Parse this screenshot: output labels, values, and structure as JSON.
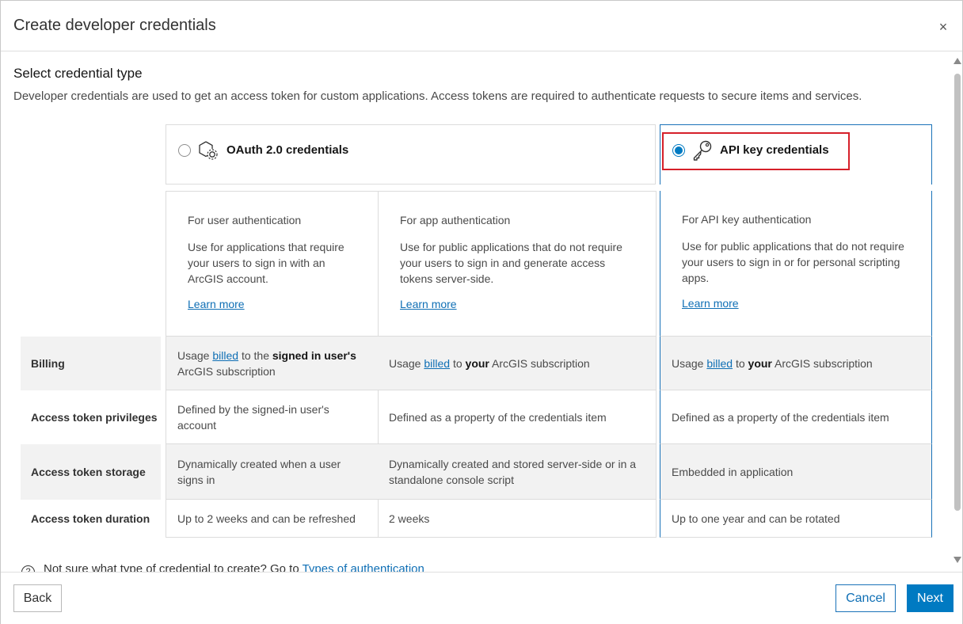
{
  "dialog": {
    "title": "Create developer credentials",
    "close_label": "×"
  },
  "section": {
    "title": "Select credential type",
    "description": "Developer credentials are used to get an access token for custom applications. Access tokens are required to authenticate requests to secure items and services."
  },
  "options": {
    "oauth": {
      "label": "OAuth 2.0 credentials",
      "selected": false,
      "icon": "gear-hexagon-icon"
    },
    "api_key": {
      "label": "API key credentials",
      "selected": true,
      "icon": "key-icon"
    }
  },
  "descriptions": [
    {
      "subtitle": "For user authentication",
      "body": "Use for applications that require your users to sign in with an ArcGIS account.",
      "link": "Learn more"
    },
    {
      "subtitle": "For app authentication",
      "body": "Use for public applications that do not require your users to sign in and generate access tokens server-side.",
      "link": "Learn more"
    },
    {
      "subtitle": "For API key authentication",
      "body": "Use for public applications that do not require your users to sign in or for personal scripting apps.",
      "link": "Learn more"
    }
  ],
  "table": {
    "rows": [
      {
        "label": "Billing",
        "cells": [
          {
            "pre": "Usage ",
            "link": "billed",
            "mid": " to the ",
            "bold": "signed in user's",
            "post": " ArcGIS subscription"
          },
          {
            "pre": "Usage ",
            "link": "billed",
            "mid": " to ",
            "bold": "your",
            "post": " ArcGIS subscription"
          },
          {
            "pre": "Usage ",
            "link": "billed",
            "mid": " to ",
            "bold": "your",
            "post": " ArcGIS subscription"
          }
        ]
      },
      {
        "label": "Access token privileges",
        "cells": [
          {
            "text": "Defined by the signed-in user's account"
          },
          {
            "text": "Defined as a property of the credentials item"
          },
          {
            "text": "Defined as a property of the credentials item"
          }
        ]
      },
      {
        "label": "Access token storage",
        "cells": [
          {
            "text": "Dynamically created when a user signs in"
          },
          {
            "text": "Dynamically created and stored server-side or in a standalone console script"
          },
          {
            "text": "Embedded in application"
          }
        ]
      },
      {
        "label": "Access token duration",
        "cells": [
          {
            "text": "Up to 2 weeks and can be refreshed"
          },
          {
            "text": "2 weeks"
          },
          {
            "text": "Up to one year and can be rotated"
          }
        ]
      }
    ]
  },
  "help": {
    "icon": "question-circle-icon",
    "text": "Not sure what type of credential to create? Go to ",
    "link": "Types of authentication"
  },
  "footer": {
    "back": "Back",
    "cancel": "Cancel",
    "next": "Next"
  },
  "colors": {
    "accent": "#007ac2",
    "highlight": "#d6202a"
  }
}
